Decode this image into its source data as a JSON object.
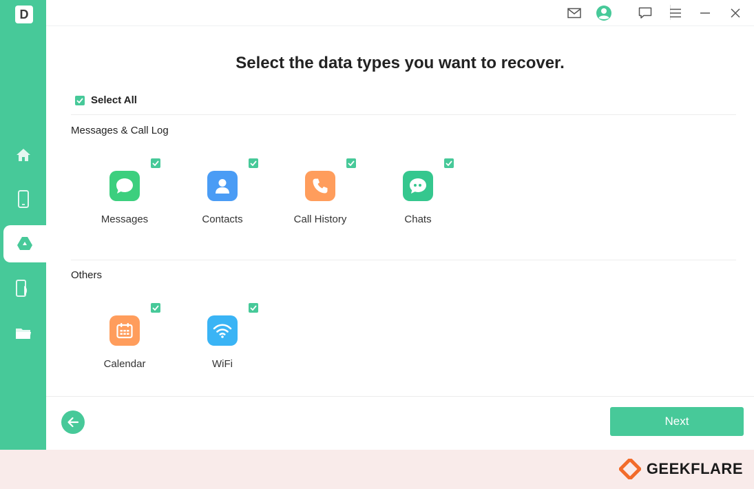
{
  "app": {
    "logo_letter": "D"
  },
  "sidebar": {
    "items": [
      {
        "icon": "home-icon",
        "active": false
      },
      {
        "icon": "phone-icon",
        "active": false
      },
      {
        "icon": "google-drive-icon",
        "active": true
      },
      {
        "icon": "device-backup-icon",
        "active": false
      },
      {
        "icon": "folder-icon",
        "active": false
      }
    ]
  },
  "titlebar": {
    "icons": [
      "mail-icon",
      "account-icon",
      "feedback-icon",
      "menu-icon",
      "minimize-icon",
      "close-icon"
    ]
  },
  "main": {
    "heading": "Select the data types you want to recover.",
    "select_all_label": "Select All",
    "select_all_checked": true,
    "sections": [
      {
        "title": "Messages & Call Log",
        "items": [
          {
            "label": "Messages",
            "icon": "messages-icon",
            "color": "#3ccf7e",
            "checked": true
          },
          {
            "label": "Contacts",
            "icon": "contacts-icon",
            "color": "#4a9cf5",
            "checked": true
          },
          {
            "label": "Call History",
            "icon": "call-history-icon",
            "color": "#ff9d5c",
            "checked": true
          },
          {
            "label": "Chats",
            "icon": "chats-icon",
            "color": "#35c78e",
            "checked": true
          }
        ]
      },
      {
        "title": "Others",
        "items": [
          {
            "label": "Calendar",
            "icon": "calendar-icon",
            "color": "#ff9d5c",
            "checked": true
          },
          {
            "label": "WiFi",
            "icon": "wifi-icon",
            "color": "#3ab4f5",
            "checked": true
          }
        ]
      }
    ]
  },
  "footer": {
    "next_label": "Next"
  },
  "watermark": {
    "brand": "GEEKFLARE"
  },
  "colors": {
    "accent": "#47c999",
    "banner": "#f9ebea",
    "brand_orange": "#f26b2a"
  }
}
